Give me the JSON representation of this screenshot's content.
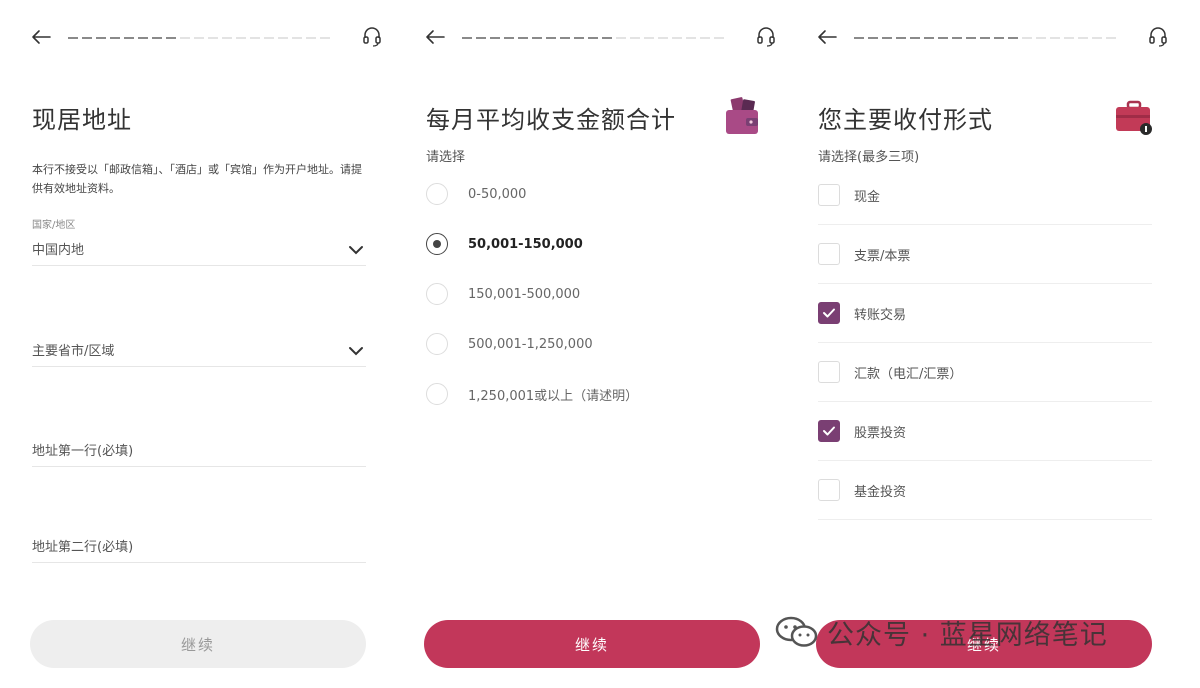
{
  "panel1": {
    "title": "现居地址",
    "note": "本行不接受以「邮政信箱」、「酒店」或「宾馆」作为开户地址。请提供有效地址资料。",
    "country_label": "国家/地区",
    "country_value": "中国内地",
    "province_placeholder": "主要省市/区域",
    "address1_placeholder": "地址第一行(必填)",
    "address2_placeholder": "地址第二行(必填)",
    "continue_label": "继续"
  },
  "panel2": {
    "title": "每月平均收支金额合计",
    "sublabel": "请选择",
    "options": [
      {
        "label": "0-50,000",
        "selected": false
      },
      {
        "label": "50,001-150,000",
        "selected": true
      },
      {
        "label": "150,001-500,000",
        "selected": false
      },
      {
        "label": "500,001-1,250,000",
        "selected": false
      },
      {
        "label": "1,250,001或以上（请述明）",
        "selected": false
      }
    ],
    "continue_label": "继续"
  },
  "panel3": {
    "title": "您主要收付形式",
    "sublabel": "请选择(最多三项)",
    "options": [
      {
        "label": "现金",
        "checked": false
      },
      {
        "label": "支票/本票",
        "checked": false
      },
      {
        "label": "转账交易",
        "checked": true
      },
      {
        "label": "汇款（电汇/汇票）",
        "checked": false
      },
      {
        "label": "股票投资",
        "checked": true
      },
      {
        "label": "基金投资",
        "checked": false
      }
    ],
    "continue_label": "继续"
  },
  "watermark": {
    "text": "公众号 · 蓝星网络笔记"
  },
  "colors": {
    "accent": "#c2375a",
    "checkbox": "#7a3f73",
    "disabled_button": "#eeeeee"
  },
  "icons": [
    "back-arrow-icon",
    "headset-icon",
    "chevron-down-icon",
    "wallet-icon",
    "briefcase-icon",
    "wechat-icon"
  ]
}
